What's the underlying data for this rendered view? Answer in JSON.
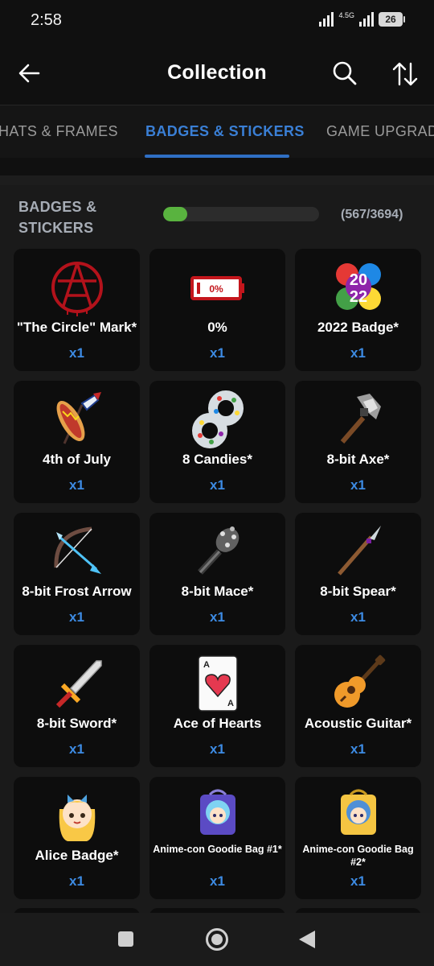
{
  "status_bar": {
    "time": "2:58",
    "network": "4.5G",
    "battery": "26"
  },
  "app_bar": {
    "title": "Collection"
  },
  "tabs": [
    {
      "label": "HATS & FRAMES",
      "active": false
    },
    {
      "label": "BADGES & STICKERS",
      "active": true
    },
    {
      "label": "GAME UPGRADES",
      "active": false
    }
  ],
  "section": {
    "title": "BADGES & STICKERS",
    "count": "(567/3694)",
    "progress_fraction": 0.1535,
    "progress_color": "#59b33f"
  },
  "accent_color": "#3d8be3",
  "items": [
    {
      "name": "\"The Circle\" Mark*",
      "qty": "x1",
      "icon": "circle-mark-icon"
    },
    {
      "name": "0%",
      "qty": "x1",
      "icon": "empty-battery-icon"
    },
    {
      "name": "2022 Badge*",
      "qty": "x1",
      "icon": "2022-badge-icon"
    },
    {
      "name": "4th of July",
      "qty": "x1",
      "icon": "hotdog-rocket-icon"
    },
    {
      "name": "8 Candies*",
      "qty": "x1",
      "icon": "candy-eight-icon"
    },
    {
      "name": "8-bit Axe*",
      "qty": "x1",
      "icon": "pixel-axe-icon"
    },
    {
      "name": "8-bit Frost Arrow",
      "qty": "x1",
      "icon": "pixel-bow-icon"
    },
    {
      "name": "8-bit Mace*",
      "qty": "x1",
      "icon": "pixel-mace-icon"
    },
    {
      "name": "8-bit Spear*",
      "qty": "x1",
      "icon": "pixel-spear-icon"
    },
    {
      "name": "8-bit Sword*",
      "qty": "x1",
      "icon": "pixel-sword-icon"
    },
    {
      "name": "Ace of Hearts",
      "qty": "x1",
      "icon": "ace-of-hearts-icon"
    },
    {
      "name": "Acoustic Guitar*",
      "qty": "x1",
      "icon": "guitar-icon"
    },
    {
      "name": "Alice Badge*",
      "qty": "x1",
      "icon": "alice-icon"
    },
    {
      "name": "Anime-con Goodie Bag #1*",
      "qty": "x1",
      "icon": "anime-bag-icon"
    },
    {
      "name": "Anime-con Goodie Bag #2*",
      "qty": "x1",
      "icon": "anime-bag-icon"
    }
  ]
}
